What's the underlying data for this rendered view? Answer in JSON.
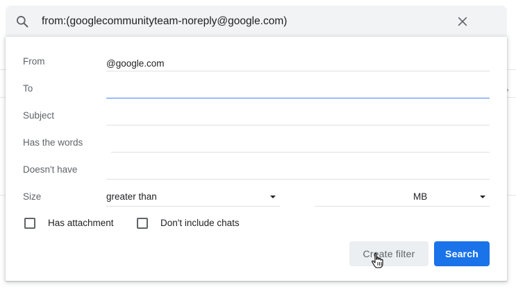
{
  "search": {
    "query": "from:(googlecommunityteam-noreply@google.com)",
    "search_icon": "search-icon",
    "close_icon": "close-icon"
  },
  "background": {
    "snippet": "n,"
  },
  "filter": {
    "fields": {
      "from": {
        "label": "From",
        "value": "@google.com"
      },
      "to": {
        "label": "To",
        "value": ""
      },
      "subject": {
        "label": "Subject",
        "value": ""
      },
      "has_words": {
        "label": "Has the words",
        "value": ""
      },
      "doesnt_have": {
        "label": "Doesn't have",
        "value": ""
      }
    },
    "size": {
      "label": "Size",
      "comparison": "greater than",
      "value": "",
      "unit": "MB"
    },
    "checkboxes": {
      "has_attachment": {
        "label": "Has attachment",
        "checked": false
      },
      "dont_include_chats": {
        "label": "Don't include chats",
        "checked": false
      }
    },
    "buttons": {
      "create_filter": "Create filter",
      "search": "Search"
    }
  },
  "colors": {
    "accent": "#1a73e8",
    "focus_underline": "#4285f4",
    "label_gray": "#5f6368"
  }
}
